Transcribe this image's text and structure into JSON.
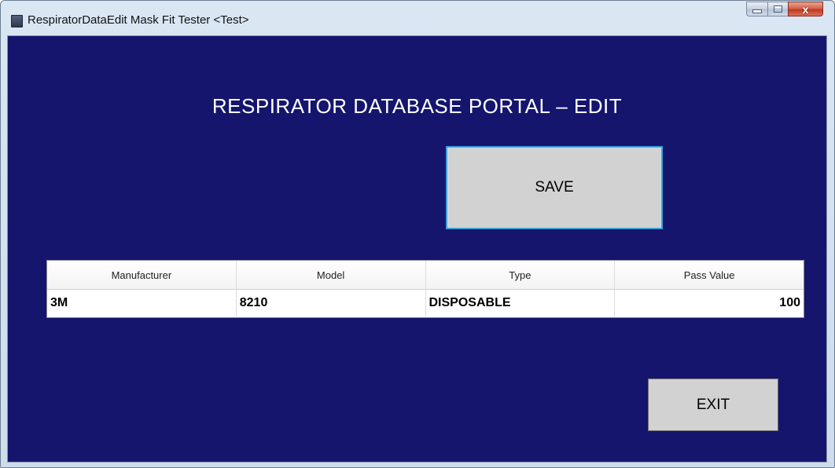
{
  "window": {
    "title": "RespiratorDataEdit Mask Fit Tester <Test>",
    "controls": {
      "close_glyph": "x"
    }
  },
  "main": {
    "heading": "RESPIRATOR DATABASE PORTAL – EDIT",
    "save_label": "SAVE",
    "exit_label": "EXIT"
  },
  "grid": {
    "columns": [
      "Manufacturer",
      "Model",
      "Type",
      "Pass Value"
    ],
    "rows": [
      [
        "3M",
        "8210",
        "DISPOSABLE",
        "100"
      ]
    ]
  },
  "colors": {
    "background": "#15156e",
    "button_face": "#d2d2d2",
    "save_focus_border": "#3d9fd8",
    "heading_text": "#ffffff"
  },
  "icons": {
    "app": "app-window-icon",
    "minimize": "minimize-icon",
    "maximize": "maximize-icon",
    "close": "close-icon"
  }
}
